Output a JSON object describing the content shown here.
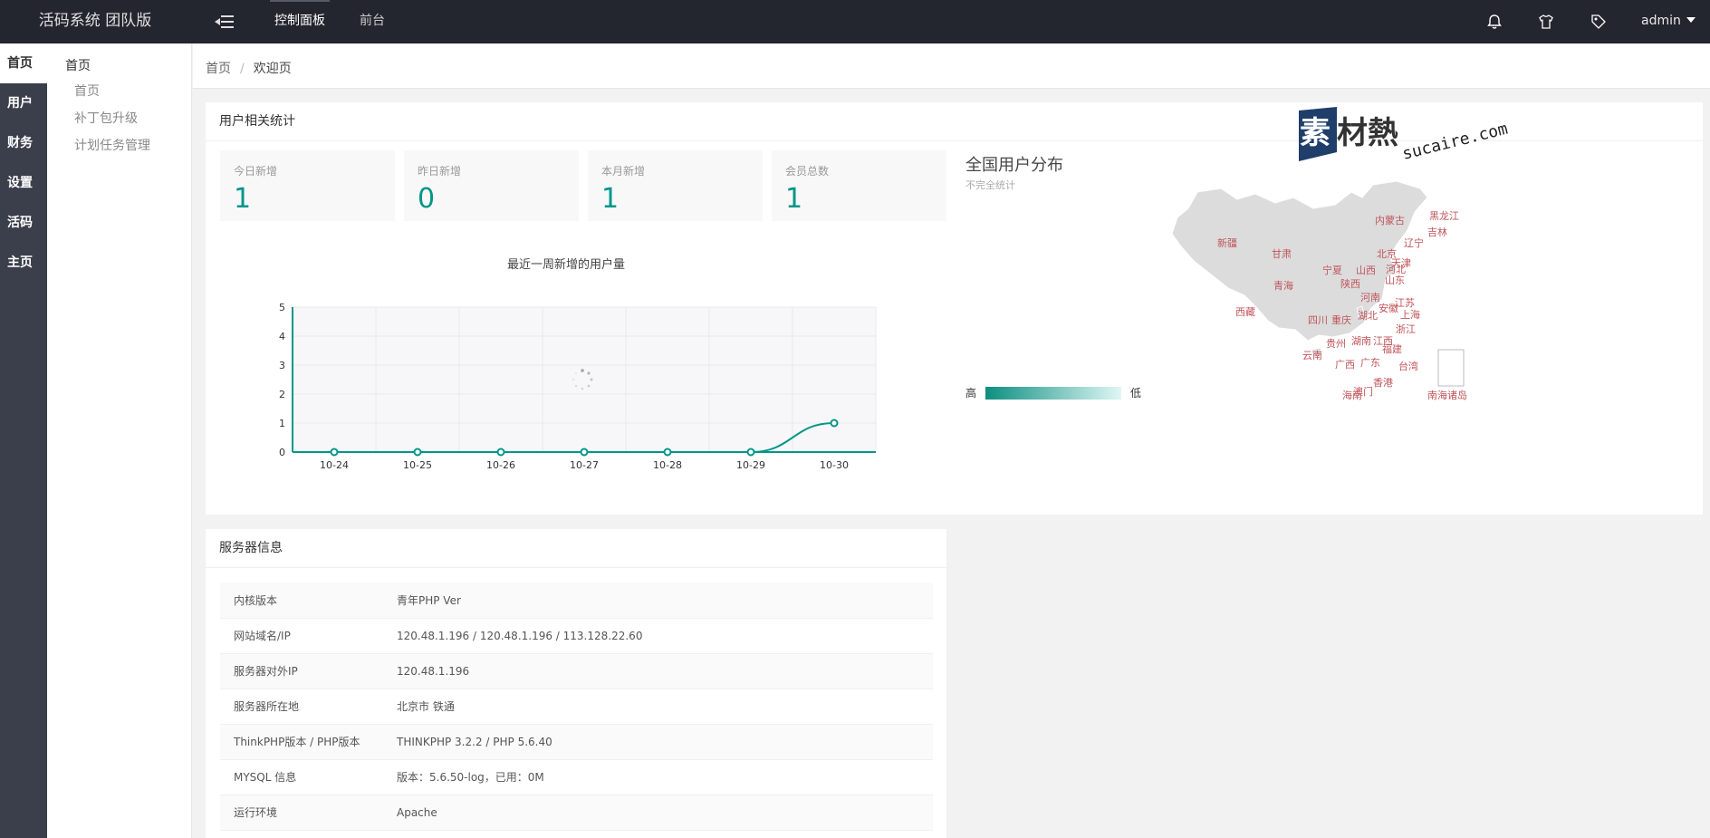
{
  "app": {
    "title": "活码系统 团队版"
  },
  "header": {
    "nav": [
      "控制面板",
      "前台"
    ],
    "user": "admin",
    "icons": [
      "bell-icon",
      "shirt-icon",
      "tag-icon"
    ]
  },
  "rail": {
    "items": [
      "首页",
      "用户",
      "财务",
      "设置",
      "活码",
      "主页"
    ]
  },
  "submenu": {
    "title": "首页",
    "items": [
      "首页",
      "补丁包升级",
      "计划任务管理"
    ]
  },
  "breadcrumb": {
    "home": "首页",
    "sep": "/",
    "current": "欢迎页"
  },
  "stats": {
    "title": "用户相关统计",
    "items": [
      {
        "label": "今日新增",
        "value": "1"
      },
      {
        "label": "昨日新增",
        "value": "0"
      },
      {
        "label": "本月新增",
        "value": "1"
      },
      {
        "label": "会员总数",
        "value": "1"
      }
    ]
  },
  "chart_data": {
    "type": "line",
    "title": "最近一周新增的用户量",
    "categories": [
      "10-24",
      "10-25",
      "10-26",
      "10-27",
      "10-28",
      "10-29",
      "10-30"
    ],
    "values": [
      0,
      0,
      0,
      0,
      0,
      0,
      1
    ],
    "ylim": [
      0,
      5
    ],
    "yticks": [
      "0",
      "1",
      "2",
      "3",
      "4",
      "5"
    ],
    "color": "#009688",
    "grid": true
  },
  "map": {
    "title": "全国用户分布",
    "subtitle": "不完全统计",
    "legend_high": "高",
    "legend_low": "低",
    "provinces": [
      "黑龙江",
      "吉林",
      "内蒙古",
      "辽宁",
      "北京",
      "天津",
      "河北",
      "新疆",
      "甘肃",
      "宁夏",
      "山西",
      "山东",
      "青海",
      "陕西",
      "河南",
      "江苏",
      "西藏",
      "四川",
      "重庆",
      "湖北",
      "安徽",
      "上海",
      "浙江",
      "贵州",
      "湖南",
      "江西",
      "福建",
      "云南",
      "广西",
      "广东",
      "台湾",
      "香港",
      "澳门",
      "海南",
      "南海诸岛"
    ]
  },
  "watermark": {
    "brand": "素材熱",
    "url": "sucaire.com"
  },
  "server": {
    "title": "服务器信息",
    "rows": [
      {
        "k": "内核版本",
        "v": "青年PHP Ver"
      },
      {
        "k": "网站域名/IP",
        "v": "120.48.1.196 / 120.48.1.196 / 113.128.22.60"
      },
      {
        "k": "服务器对外IP",
        "v": "120.48.1.196"
      },
      {
        "k": "服务器所在地",
        "v": "北京市 铁通"
      },
      {
        "k": "ThinkPHP版本 / PHP版本",
        "v": "THINKPHP 3.2.2 / PHP 5.6.40"
      },
      {
        "k": "MYSQL 信息",
        "v": "版本：5.6.50-log，已用：0M"
      },
      {
        "k": "运行环境",
        "v": "Apache"
      }
    ]
  }
}
